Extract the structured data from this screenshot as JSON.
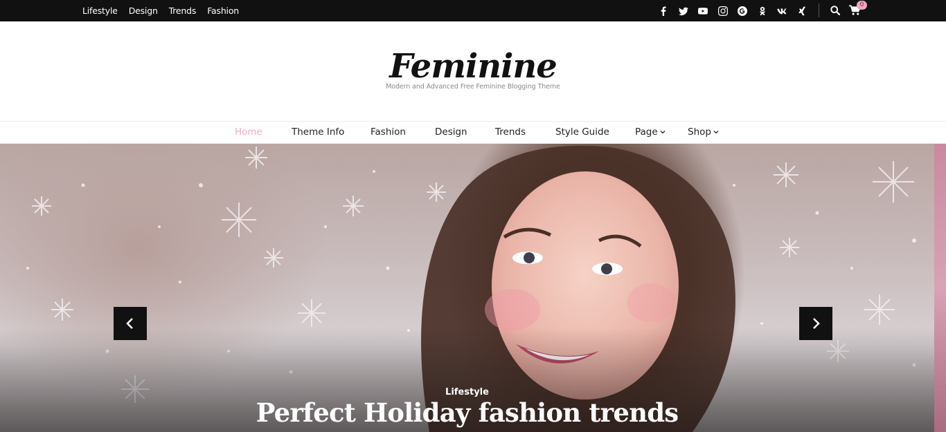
{
  "topbar": {
    "links": [
      "Lifestyle",
      "Design",
      "Trends",
      "Fashion"
    ],
    "social_icons": [
      "facebook-icon",
      "twitter-icon",
      "youtube-icon",
      "instagram-icon",
      "google-plus-icon",
      "odnoklassniki-icon",
      "vk-icon",
      "xing-icon"
    ],
    "cart_count": "0"
  },
  "header": {
    "site_title": "Feminine",
    "tagline": "Modern and Advanced Free Feminine Blogging Theme"
  },
  "nav": {
    "items": [
      {
        "label": "Home",
        "active": true
      },
      {
        "label": "Theme Info"
      },
      {
        "label": "Fashion"
      },
      {
        "label": "Design"
      },
      {
        "label": "Trends"
      },
      {
        "label": "Style Guide"
      },
      {
        "label": "Page",
        "dropdown": true
      },
      {
        "label": "Shop",
        "dropdown": true
      }
    ]
  },
  "slider": {
    "category": "Lifestyle",
    "title": "Perfect Holiday fashion trends"
  },
  "colors": {
    "topbar_bg": "#111111",
    "accent": "#f2a9c0",
    "arrow_bg": "#111111"
  }
}
